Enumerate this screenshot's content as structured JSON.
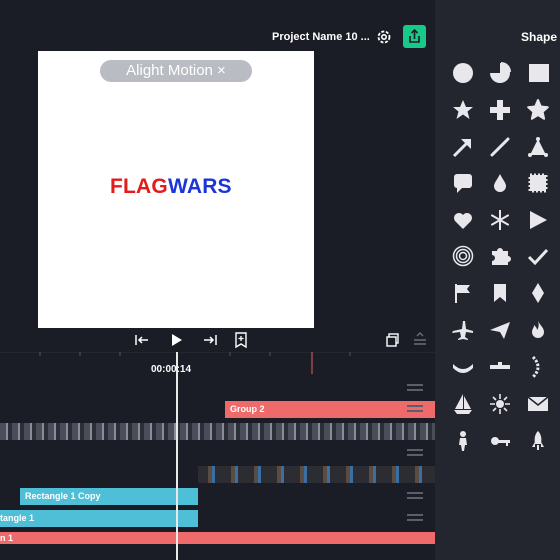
{
  "header": {
    "project_name": "Project Name 10 ..."
  },
  "preview": {
    "watermark": "Alight Motion ×",
    "flag_red": "FLAG",
    "flag_blue": "WARS"
  },
  "timeline": {
    "current_time": "00:00:14",
    "tracks": [
      {
        "label": "Group 2"
      },
      {
        "label": "Rectangle 1 Copy"
      },
      {
        "label": "tangle 1"
      },
      {
        "label": "n 1"
      }
    ]
  },
  "panel": {
    "title": "Shape",
    "shapes": [
      "circle-icon",
      "pie-icon",
      "square-icon",
      "star-icon",
      "plus-icon",
      "star-rounded-icon",
      "arrow-icon",
      "line-icon",
      "triangle-dots-icon",
      "speech-bubble-icon",
      "drop-icon",
      "stamp-icon",
      "heart-icon",
      "snowflake-icon",
      "play-triangle-icon",
      "spiral-icon",
      "puzzle-icon",
      "checkmark-icon",
      "flag-icon",
      "bookmark-icon",
      "diamond-icon",
      "airplane-icon",
      "paper-plane-icon",
      "flame-icon",
      "curve-icon",
      "dash-icon",
      "wave-icon",
      "sailboat-icon",
      "sun-icon",
      "envelope-icon",
      "person-icon",
      "key-icon",
      "rocket-icon"
    ]
  },
  "colors": {
    "accent": "#18c98a",
    "track_red": "#ef6a6a",
    "track_blue": "#4fbfd7",
    "panel_bg": "#24262f"
  }
}
